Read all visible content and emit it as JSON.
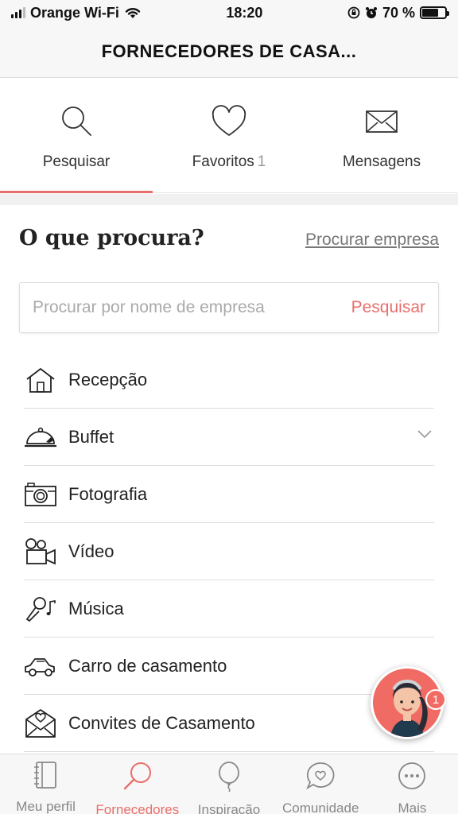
{
  "status_bar": {
    "carrier": "Orange Wi-Fi",
    "time": "18:20",
    "battery": "70 %",
    "battery_level": 0.7
  },
  "header": {
    "title": "FORNECEDORES DE CASA..."
  },
  "tabs": [
    {
      "label": "Pesquisar",
      "count": "",
      "icon": "search-icon",
      "active": true
    },
    {
      "label": "Favoritos",
      "count": "1",
      "icon": "heart-icon",
      "active": false
    },
    {
      "label": "Mensagens",
      "count": "",
      "icon": "envelope-icon",
      "active": false
    }
  ],
  "main": {
    "heading": "O que procura?",
    "search_company_link": "Procurar empresa",
    "search": {
      "placeholder": "Procurar por nome de empresa",
      "button": "Pesquisar"
    }
  },
  "categories": [
    {
      "label": "Recepção",
      "icon": "house-icon"
    },
    {
      "label": "Buffet",
      "icon": "cloche-icon"
    },
    {
      "label": "Fotografia",
      "icon": "camera-icon"
    },
    {
      "label": "Vídeo",
      "icon": "video-camera-icon"
    },
    {
      "label": "Música",
      "icon": "microphone-icon"
    },
    {
      "label": "Carro de casamento",
      "icon": "car-icon"
    },
    {
      "label": "Convites de Casamento",
      "icon": "invitation-icon"
    }
  ],
  "assistant": {
    "badge": "1"
  },
  "bottom_nav": [
    {
      "label": "Meu perfil",
      "icon": "notebook-icon",
      "active": false
    },
    {
      "label": "Fornecedores",
      "icon": "magnifier-icon",
      "active": true
    },
    {
      "label": "Inspiração",
      "icon": "balloon-icon",
      "active": false
    },
    {
      "label": "Comunidade",
      "icon": "chat-heart-icon",
      "active": false
    },
    {
      "label": "Mais",
      "icon": "more-icon",
      "active": false
    }
  ],
  "colors": {
    "accent": "#e86f6b",
    "text": "#222222",
    "muted": "#888888"
  }
}
